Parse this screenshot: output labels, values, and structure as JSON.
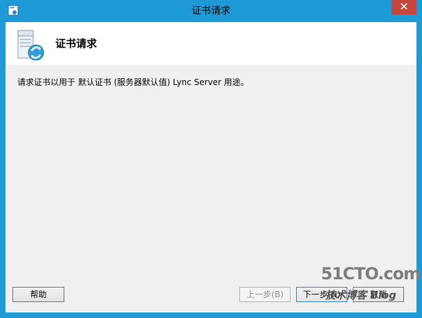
{
  "window": {
    "title": "证书请求",
    "close_glyph": "✕",
    "icon": "app-icon"
  },
  "header": {
    "title": "证书请求",
    "icon": "certificate-server-icon"
  },
  "message": "请求证书以用于 默认证书 (服务器默认值) Lync Server 用途。",
  "buttons": {
    "help": "帮助",
    "back": "上一步(B)",
    "next": "下一步(N)",
    "cancel": "取消"
  },
  "watermark": {
    "site": "51CTO.com",
    "tagline": "技术博客 Blog"
  },
  "colors": {
    "frame": "#1e9bd7",
    "close": "#c7463b",
    "client": "#f0f0f0"
  }
}
